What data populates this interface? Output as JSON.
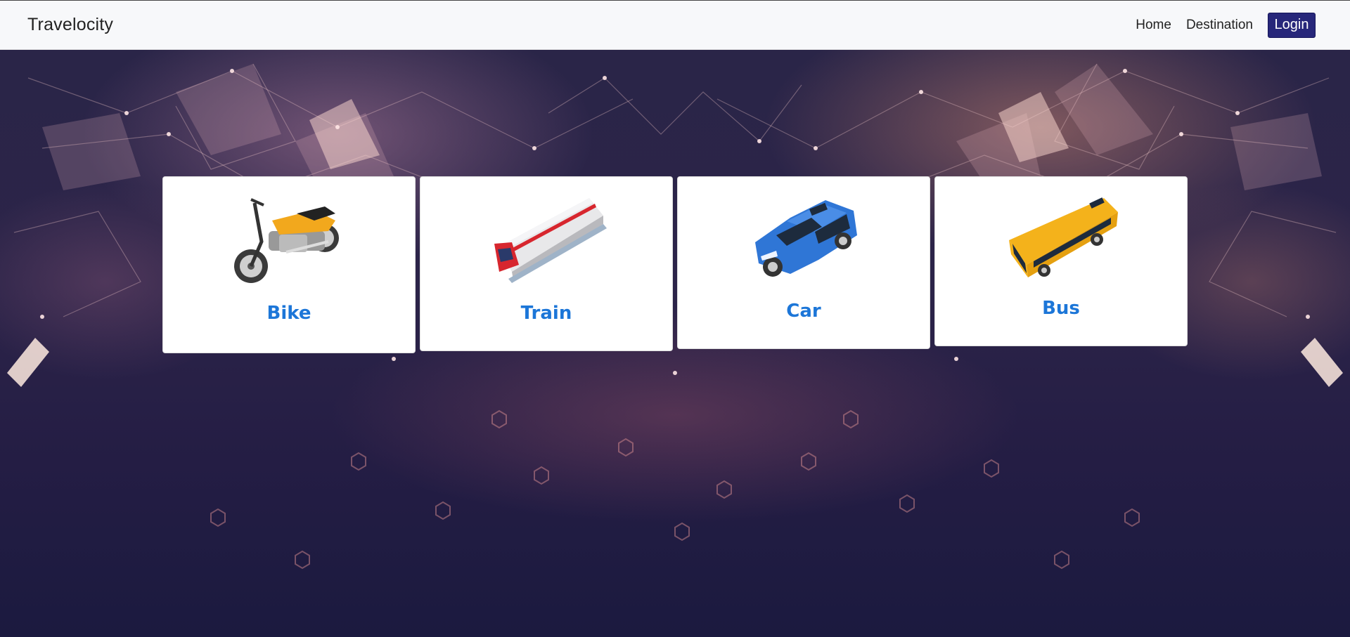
{
  "navbar": {
    "brand": "Travelocity",
    "links": [
      {
        "label": "Home"
      },
      {
        "label": "Destination"
      }
    ],
    "login_label": "Login",
    "login_color": "#27277a"
  },
  "cards": [
    {
      "label": "Bike",
      "icon": "motorcycle-icon",
      "accent": "#f2a81d"
    },
    {
      "label": "Train",
      "icon": "train-icon",
      "accent": "#d7262e"
    },
    {
      "label": "Car",
      "icon": "car-icon",
      "accent": "#2f76d6"
    },
    {
      "label": "Bus",
      "icon": "bus-icon",
      "accent": "#f4b21b"
    }
  ],
  "colors": {
    "card_label": "#1c76d8",
    "background": "#1b1c3e"
  }
}
